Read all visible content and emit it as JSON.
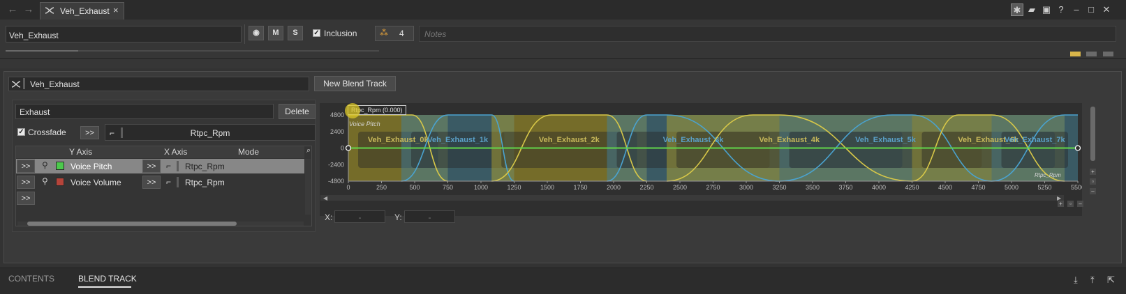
{
  "tab": {
    "title": "Veh_Exhaust",
    "close": "×"
  },
  "header": {
    "name_value": "Veh_Exhaust",
    "mute_label": "M",
    "solo_label": "S",
    "inclusion_label": "Inclusion",
    "reference_count": "4",
    "notes_placeholder": "Notes"
  },
  "panel": {
    "container_name": "Veh_Exhaust",
    "new_blend_track_label": "New Blend Track",
    "track_name": "Exhaust",
    "delete_label": "Delete",
    "crossfade_label": "Crossfade",
    "expand_label": ">>",
    "rtpc_name": "Rtpc_Rpm",
    "columns": {
      "y_axis": "Y Axis",
      "x_axis": "X Axis",
      "mode": "Mode"
    },
    "rows": [
      {
        "expand": ">>",
        "y_axis": "Voice Pitch",
        "color": "#4cc94c",
        "x_expand": ">>",
        "x_axis": "Rtpc_Rpm"
      },
      {
        "expand": ">>",
        "y_axis": "Voice Volume",
        "color": "#b5443a",
        "x_expand": ">>",
        "x_axis": "Rtpc_Rpm"
      },
      {
        "expand": ">>"
      }
    ],
    "x_label": "X:",
    "x_value": "-",
    "y_label": "Y:",
    "y_value": "-"
  },
  "chart_data": {
    "type": "line",
    "cursor_label": "Rtpc_Rpm (0.000)",
    "curve_label": "Voice Pitch",
    "axis_label": "Rtpc_Rpm",
    "x_ticks": [
      "0",
      "250",
      "500",
      "750",
      "1000",
      "1250",
      "1500",
      "1750",
      "2000",
      "2250",
      "2500",
      "2750",
      "3000",
      "3250",
      "3500",
      "3750",
      "4000",
      "4250",
      "4500",
      "4750",
      "5000",
      "5250",
      "5500"
    ],
    "y_ticks": [
      "4800",
      "2400",
      "0",
      "-2400",
      "-4800"
    ],
    "xlim": [
      0,
      5500
    ],
    "ylim": [
      -4800,
      4800
    ],
    "series": [
      {
        "name": "Voice Pitch",
        "x": [
          0,
          5500
        ],
        "y": [
          0,
          0
        ],
        "color": "#62d84a"
      }
    ],
    "blend_children": [
      {
        "name": "Veh_Exhaust_0k",
        "start": 0,
        "end": 750,
        "fade_in": [
          0,
          0
        ],
        "fade_out": [
          480,
          750
        ],
        "color": "yellow"
      },
      {
        "name": "Veh_Exhaust_1k",
        "start": 400,
        "end": 1250,
        "fade_in": [
          400,
          750
        ],
        "fade_out": [
          1080,
          1250
        ],
        "color": "blue"
      },
      {
        "name": "Veh_Exhaust_2k",
        "start": 1080,
        "end": 2250,
        "fade_in": [
          1080,
          1530
        ],
        "fade_out": [
          1950,
          2250
        ],
        "color": "yellow"
      },
      {
        "name": "Veh_Exhaust_3k",
        "start": 1950,
        "end": 3250,
        "fade_in": [
          1950,
          2250
        ],
        "fade_out": [
          2400,
          3250
        ],
        "color": "blue"
      },
      {
        "name": "Veh_Exhaust_4k",
        "start": 2400,
        "end": 4250,
        "fade_in": [
          2400,
          3050
        ],
        "fade_out": [
          3250,
          4250
        ],
        "color": "yellow"
      },
      {
        "name": "Veh_Exhaust_5k",
        "start": 3250,
        "end": 4850,
        "fade_in": [
          3250,
          4100
        ],
        "fade_out": [
          4250,
          4850
        ],
        "color": "blue"
      },
      {
        "name": "Veh_Exhaust_6k",
        "start": 4250,
        "end": 5400,
        "fade_in": [
          4250,
          4600
        ],
        "fade_out": [
          4850,
          5400
        ],
        "color": "yellow"
      },
      {
        "name": "Veh_Exhaust_7k",
        "start": 4850,
        "end": 5500,
        "fade_in": [
          4850,
          5400
        ],
        "fade_out": [
          5500,
          5500
        ],
        "color": "blue"
      }
    ]
  },
  "bottom_tabs": {
    "contents": "CONTENTS",
    "blend_track": "BLEND TRACK"
  }
}
